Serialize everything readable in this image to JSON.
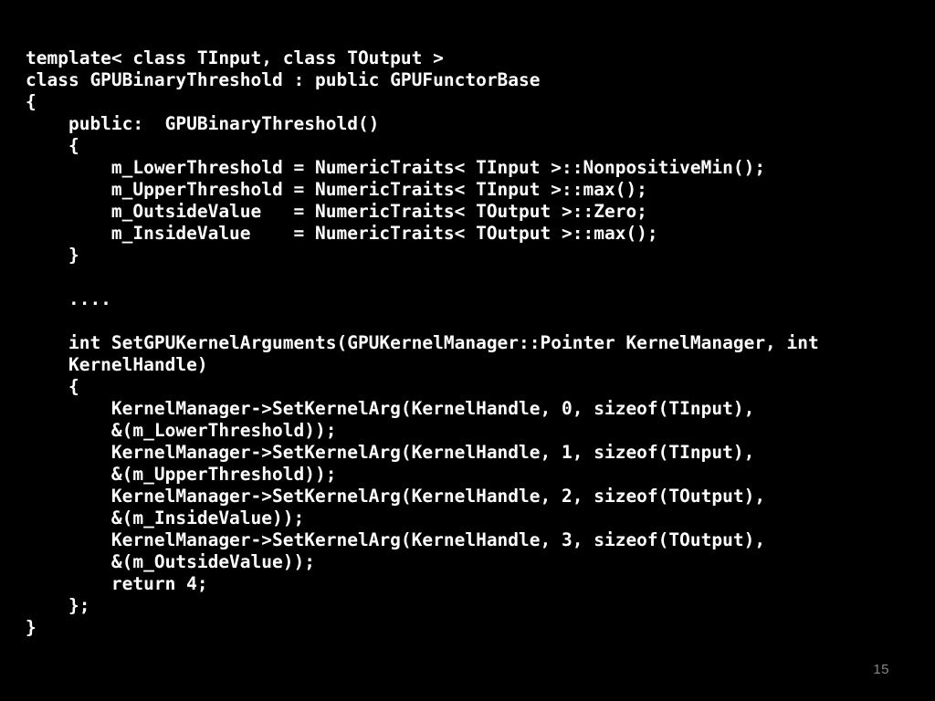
{
  "slide": {
    "background_color": "#000000",
    "code_color": "#ffffff",
    "page_number_color": "#878787",
    "page_number": "15",
    "code_lines": [
      "template< class TInput, class TOutput >",
      "class GPUBinaryThreshold : public GPUFunctorBase",
      "{",
      "    public:  GPUBinaryThreshold()",
      "    {",
      "        m_LowerThreshold = NumericTraits< TInput >::NonpositiveMin();",
      "        m_UpperThreshold = NumericTraits< TInput >::max();",
      "        m_OutsideValue   = NumericTraits< TOutput >::Zero;",
      "        m_InsideValue    = NumericTraits< TOutput >::max();",
      "    }",
      "",
      "    ....",
      "",
      "    int SetGPUKernelArguments(GPUKernelManager::Pointer KernelManager, int",
      "    KernelHandle)",
      "    {",
      "        KernelManager->SetKernelArg(KernelHandle, 0, sizeof(TInput),",
      "        &(m_LowerThreshold));",
      "        KernelManager->SetKernelArg(KernelHandle, 1, sizeof(TInput),",
      "        &(m_UpperThreshold));",
      "        KernelManager->SetKernelArg(KernelHandle, 2, sizeof(TOutput),",
      "        &(m_InsideValue));",
      "        KernelManager->SetKernelArg(KernelHandle, 3, sizeof(TOutput),",
      "        &(m_OutsideValue));",
      "        return 4;",
      "    };",
      "}"
    ]
  }
}
